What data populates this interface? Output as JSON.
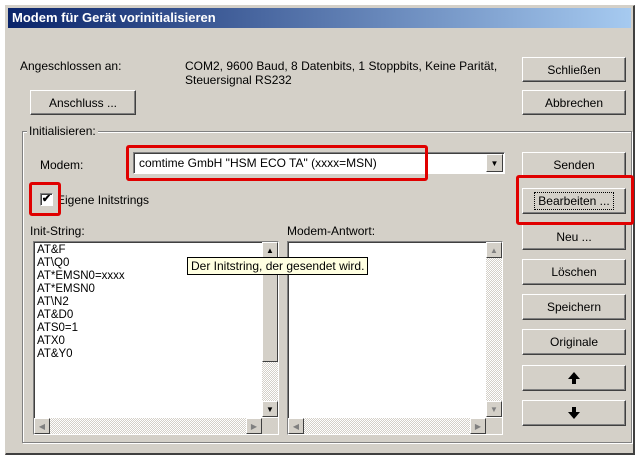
{
  "window": {
    "title": "Modem für Gerät vorinitialisieren"
  },
  "connection": {
    "label": "Angeschlossen an:",
    "value": "COM2, 9600 Baud, 8 Datenbits, 1 Stoppbits, Keine Parität, Steuersignal RS232",
    "button": "Anschluss ..."
  },
  "buttons": {
    "close": "Schließen",
    "cancel": "Abbrechen",
    "send": "Senden",
    "edit": "Bearbeiten ...",
    "new": "Neu ...",
    "delete": "Löschen",
    "save": "Speichern",
    "originals": "Originale",
    "up_icon": "arrow-up-icon",
    "down_icon": "arrow-down-icon"
  },
  "init_group": {
    "label": "Initialisieren:",
    "modem_label": "Modem:",
    "modem_value": "comtime GmbH \"HSM ECO TA\" (xxxx=MSN)",
    "own_strings_label": "Eigene Initstrings",
    "own_strings_checked": true,
    "init_string_label": "Init-String:",
    "modem_response_label": "Modem-Antwort:",
    "init_strings": [
      "AT&F",
      "AT\\Q0",
      "AT*EMSN0=xxxx",
      "AT*EMSN0",
      "AT\\N2",
      "AT&D0",
      "ATS0=1",
      "ATX0",
      "AT&Y0"
    ],
    "tooltip": "Der Initstring, der gesendet wird."
  },
  "highlight_color": "#e00000"
}
